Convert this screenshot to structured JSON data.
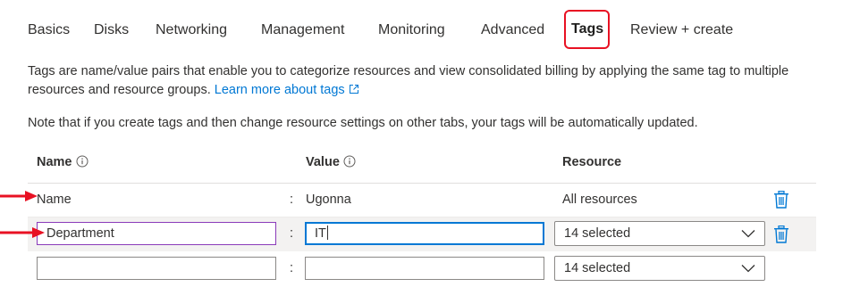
{
  "tabs": [
    {
      "label": "Basics"
    },
    {
      "label": "Disks"
    },
    {
      "label": "Networking"
    },
    {
      "label": "Management"
    },
    {
      "label": "Monitoring"
    },
    {
      "label": "Advanced"
    },
    {
      "label": "Tags",
      "active": true
    },
    {
      "label": "Review + create"
    }
  ],
  "description": {
    "text": "Tags are name/value pairs that enable you to categorize resources and view consolidated billing by applying the same tag to multiple resources and resource groups.",
    "link_label": "Learn more about tags"
  },
  "note": "Note that if you create tags and then change resource settings on other tabs, your tags will be automatically updated.",
  "table": {
    "headers": {
      "name": "Name",
      "value": "Value",
      "resource": "Resource"
    },
    "separator": ":",
    "rows": [
      {
        "name": "Name",
        "value": "Ugonna",
        "resource": "All resources"
      },
      {
        "name": "Department",
        "value": "IT",
        "resource": "14 selected"
      },
      {
        "name": "",
        "value": "",
        "resource": "14 selected"
      }
    ]
  },
  "colors": {
    "accent": "#0078d4",
    "highlight": "#e81123",
    "annotation_arrow": "#e81123"
  }
}
